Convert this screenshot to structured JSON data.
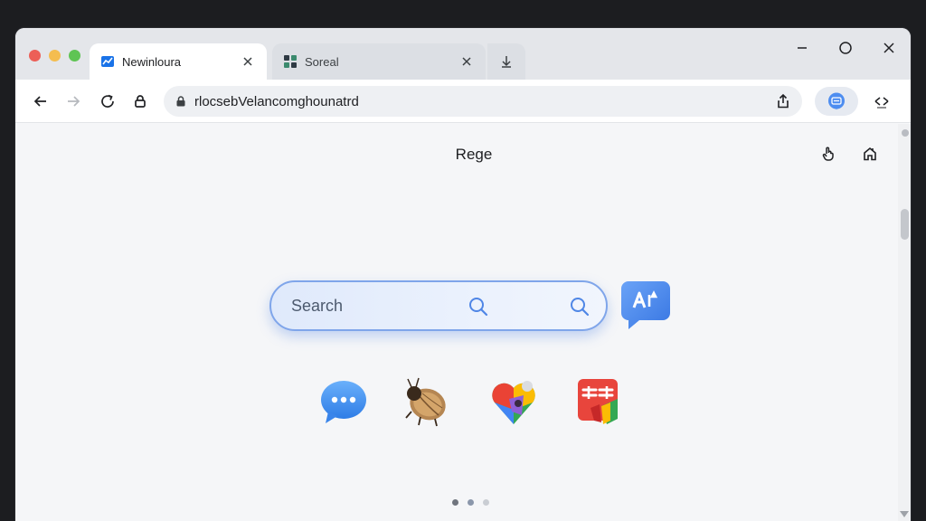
{
  "browser": {
    "tabs": [
      {
        "title": "Newinloura",
        "active": true,
        "favicon": "chart-favicon-icon"
      },
      {
        "title": "Soreal",
        "active": false,
        "favicon": "grid-favicon-icon"
      }
    ],
    "address_bar": {
      "url": "rlocsebVelancomghounatrd"
    }
  },
  "page": {
    "title": "Rege",
    "search": {
      "placeholder": "Search"
    },
    "shortcuts": [
      {
        "icon": "chat-bubble-icon"
      },
      {
        "icon": "beetle-icon"
      },
      {
        "icon": "map-pin-heart-icon"
      },
      {
        "icon": "red-app-icon"
      }
    ],
    "pagination": {
      "pages": 3,
      "current": 2
    }
  },
  "colors": {
    "accent": "#4f8ef0",
    "search_border": "#7fa5ea"
  }
}
